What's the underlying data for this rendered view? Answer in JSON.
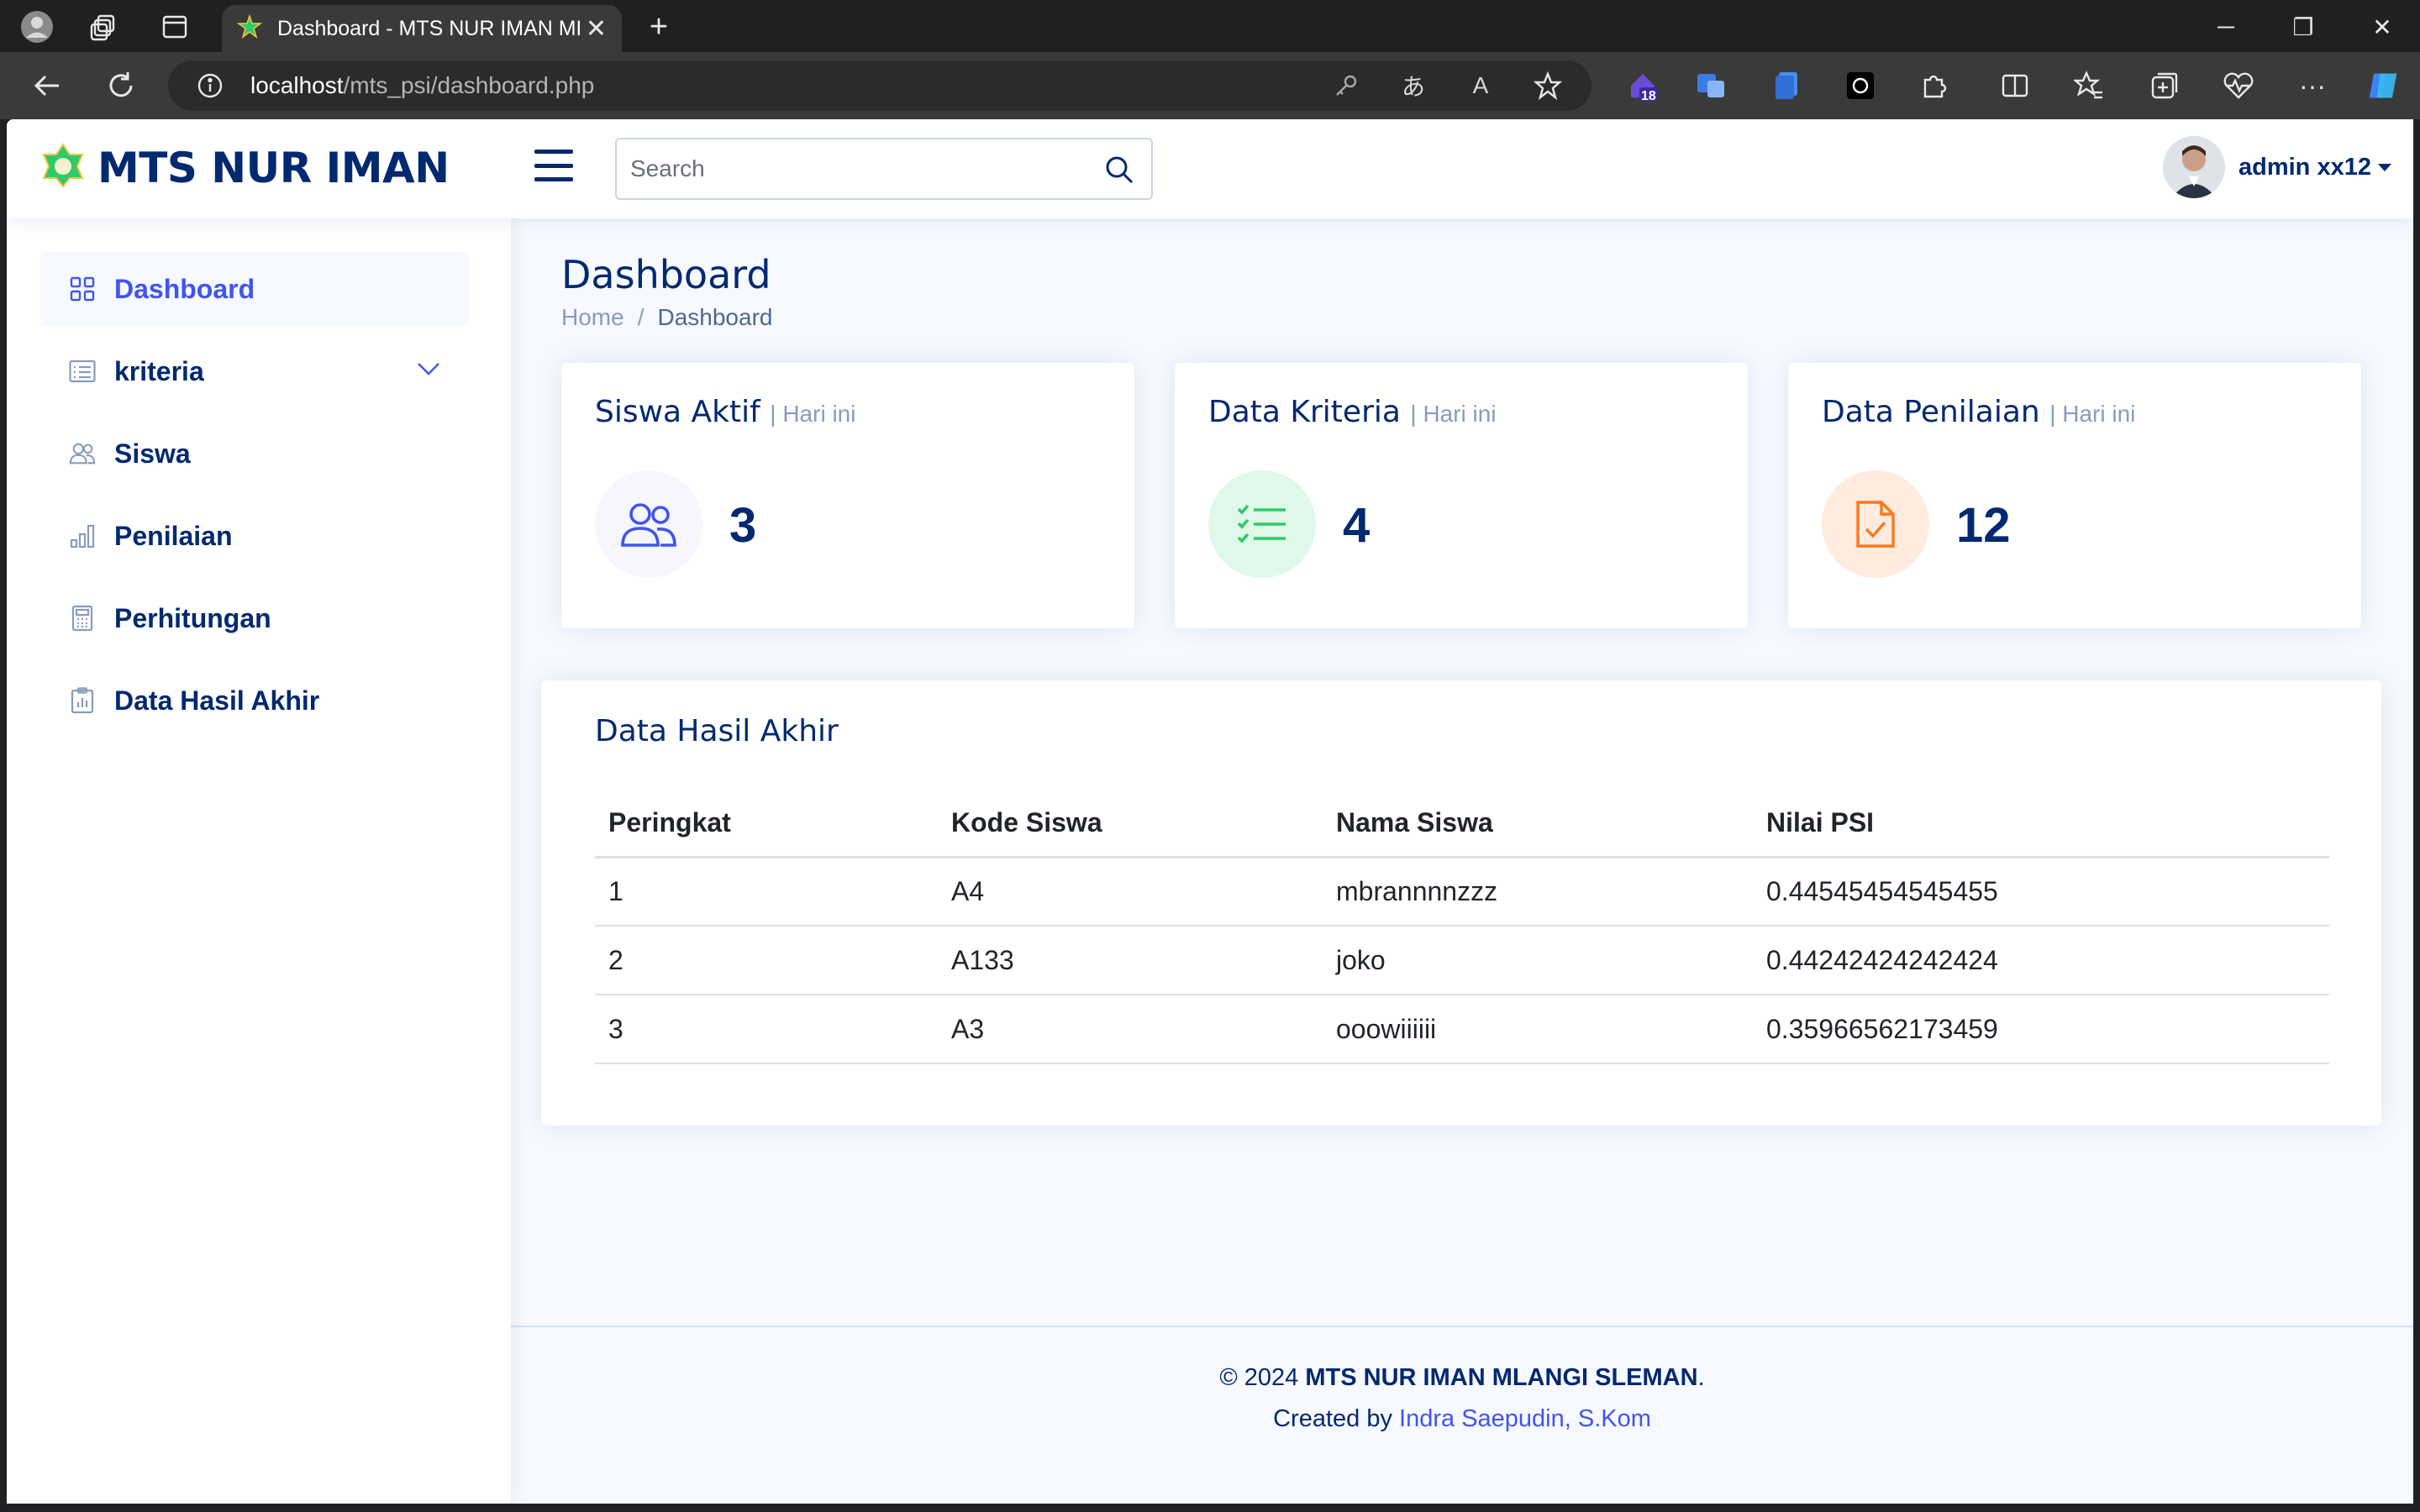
{
  "browser": {
    "tab_title": "Dashboard - MTS NUR IMAN ML",
    "url_host": "localhost",
    "url_path": "/mts_psi/dashboard.php",
    "extension_badge": "18"
  },
  "header": {
    "logo_text": "MTS NUR IMAN",
    "search_placeholder": "Search",
    "profile_name": "admin xx12"
  },
  "sidebar": {
    "items": [
      {
        "label": "Dashboard",
        "icon": "grid-icon"
      },
      {
        "label": "kriteria",
        "icon": "card-list-icon"
      },
      {
        "label": "Siswa",
        "icon": "people-icon"
      },
      {
        "label": "Penilaian",
        "icon": "bar-chart-icon"
      },
      {
        "label": "Perhitungan",
        "icon": "calculator-icon"
      },
      {
        "label": "Data Hasil Akhir",
        "icon": "clipboard-data-icon"
      }
    ]
  },
  "main": {
    "page_title": "Dashboard",
    "breadcrumb": {
      "home": "Home",
      "separator": "/",
      "current": "Dashboard"
    },
    "cards": [
      {
        "title": "Siswa Aktif",
        "subtitle": "| Hari ini",
        "value": "3",
        "icon": "people-icon",
        "color": "#4154f1",
        "bg": "#f6f6fe"
      },
      {
        "title": "Data Kriteria",
        "subtitle": "| Hari ini",
        "value": "4",
        "icon": "list-check-icon",
        "color": "#2eca6a",
        "bg": "#e0f8e9"
      },
      {
        "title": "Data Penilaian",
        "subtitle": "| Hari ini",
        "value": "12",
        "icon": "file-check-icon",
        "color": "#ff771d",
        "bg": "#ffecdf"
      }
    ],
    "table": {
      "title": "Data Hasil Akhir",
      "headers": [
        "Peringkat",
        "Kode Siswa",
        "Nama Siswa",
        "Nilai PSI"
      ],
      "rows": [
        [
          "1",
          "A4",
          "mbrannnnzzz",
          "0.44545454545455"
        ],
        [
          "2",
          "A133",
          "joko",
          "0.44242424242424"
        ],
        [
          "3",
          "A3",
          "ooowiiiiii",
          "0.35966562173459"
        ]
      ]
    }
  },
  "footer": {
    "copyright_prefix": "© 2024",
    "org": "MTS NUR IMAN MLANGI SLEMAN",
    "period": ".",
    "created_by": "Created by",
    "author": "Indra Saepudin, S.Kom"
  }
}
